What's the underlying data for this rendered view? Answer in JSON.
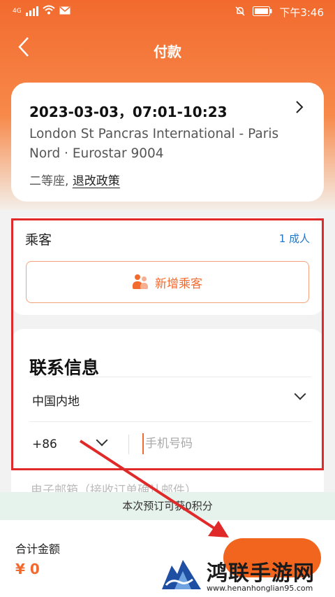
{
  "status_bar": {
    "network": "4G",
    "time": "下午3:46"
  },
  "nav": {
    "title": "付款"
  },
  "trip": {
    "datetime": "2023-03-03，07:01-10:23",
    "route": "London St Pancras International - Paris Nord · Eurostar 9004",
    "seat_class": "二等座,",
    "policy_link": "退改政策"
  },
  "passengers": {
    "title": "乘客",
    "count": "1 成人",
    "add_button": "新增乘客"
  },
  "contact": {
    "title": "联系信息",
    "region": "中国内地",
    "country_code": "+86",
    "phone_placeholder": "手机号码",
    "email_placeholder": "电子邮箱（接收订单确认邮件）"
  },
  "points_notice": "本次预订可获0积分",
  "footer": {
    "total_label": "合计金额",
    "total_value": "¥ 0"
  },
  "watermark": {
    "brand": "鸿联手游网",
    "url": "www.henanhonglian95.com"
  },
  "colors": {
    "accent": "#f26a2e",
    "link": "#2277cc",
    "highlight": "#e02a2a"
  }
}
